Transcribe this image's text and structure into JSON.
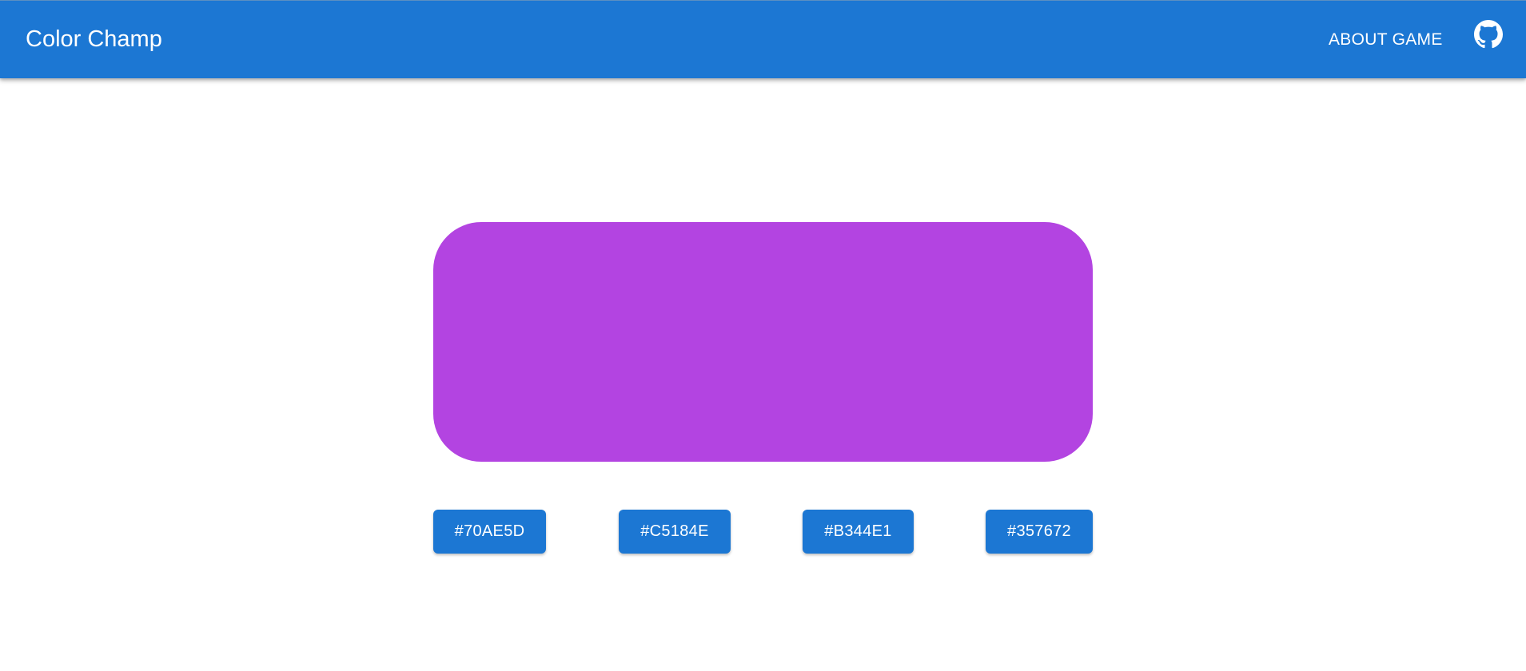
{
  "header": {
    "title": "Color Champ",
    "about_label": "ABOUT GAME",
    "github_icon": "github-icon"
  },
  "game": {
    "target_color": "#B344E1",
    "options": [
      {
        "label": "#70AE5D"
      },
      {
        "label": "#C5184E"
      },
      {
        "label": "#B344E1"
      },
      {
        "label": "#357672"
      }
    ]
  },
  "colors": {
    "primary": "#1c77d3",
    "button_text": "#ffffff"
  }
}
